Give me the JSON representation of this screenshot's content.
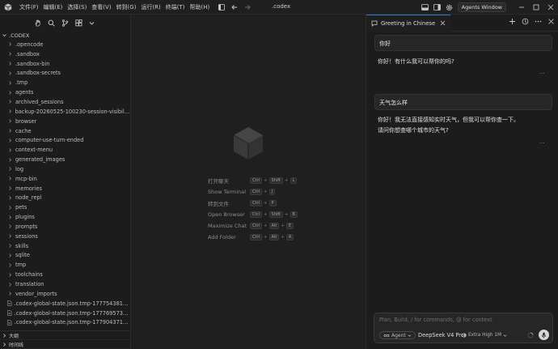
{
  "menu": [
    "文件(F)",
    "编辑(E)",
    "选择(S)",
    "查看(V)",
    "转到(G)",
    "运行(R)",
    "终端(T)",
    "帮助(H)"
  ],
  "window_title": ".codex",
  "agents_window_label": "Agents Window",
  "explorer": {
    "root": ".CODEX",
    "folders": [
      ".opencode",
      ".sandbox",
      ".sandbox-bin",
      ".sandbox-secrets",
      ".tmp",
      "agents",
      "archived_sessions",
      "backup-20260525-100230-session-visibility-...",
      "browser",
      "cache",
      "computer-use-turn-ended",
      "context-menu",
      "generated_images",
      "log",
      "mcp-bin",
      "memories",
      "node_repl",
      "pets",
      "plugins",
      "prompts",
      "sessions",
      "skills",
      "sqlite",
      "tmp",
      "toolchains",
      "translation",
      "vendor_imports"
    ],
    "files": [
      ".codex-global-state.json.tmp-177754381333...",
      ".codex-global-state.json.tmp-177769573818...",
      ".codex-global-state.json.tmp-177904371719..."
    ],
    "outline_label": "大纲",
    "timeline_label": "时间线"
  },
  "shortcuts": [
    {
      "label": "打开聊天",
      "keys": [
        "Ctrl",
        "Shift",
        "L"
      ]
    },
    {
      "label": "Show Terminal",
      "keys": [
        "Ctrl",
        "J"
      ]
    },
    {
      "label": "转到文件",
      "keys": [
        "Ctrl",
        "P"
      ]
    },
    {
      "label": "Open Browser",
      "keys": [
        "Ctrl",
        "Shift",
        "B"
      ]
    },
    {
      "label": "Maximize Chat",
      "keys": [
        "Ctrl",
        "Alt",
        "E"
      ]
    },
    {
      "label": "Add Folder",
      "keys": [
        "Ctrl",
        "Alt",
        "A"
      ]
    }
  ],
  "chat": {
    "tab_title": "Greeting in Chinese",
    "messages": [
      {
        "user": "你好",
        "assistant_lines": [
          "你好！有什么我可以帮你的吗?"
        ]
      },
      {
        "user": "天气怎么样",
        "assistant_lines": [
          "你好！我无法直接感知实时天气，但我可以帮你查一下。",
          "请问你想查哪个城市的天气?"
        ]
      }
    ],
    "dots": "···",
    "composer_placeholder": "Plan, Build, / for commands, @ for context",
    "mode_label": "Agent",
    "model_label": "DeepSeek V4 Pro",
    "effort_label": "Extra High 1M"
  }
}
